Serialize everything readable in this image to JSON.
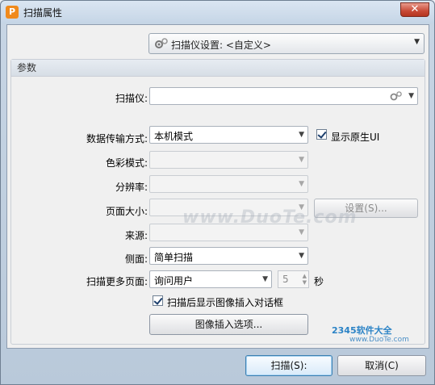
{
  "window": {
    "title": "扫描属性",
    "close": "✕",
    "app_letter": "P"
  },
  "preset": {
    "label": "扫描仪设置: <自定义>"
  },
  "params": {
    "header": "参数",
    "scanner_label": "扫描仪:",
    "scanner_value": "",
    "transfer_label": "数据传输方式:",
    "transfer_value": "本机模式",
    "show_native_label": "显示原生UI",
    "color_label": "色彩模式:",
    "resolution_label": "分辨率:",
    "page_size_label": "页面大小:",
    "page_size_button": "设置(S)...",
    "source_label": "来源:",
    "sides_label": "侧面:",
    "sides_value": "简单扫描",
    "more_pages_label": "扫描更多页面:",
    "more_pages_value": "询问用户",
    "more_pages_count": "5",
    "seconds_label": "秒",
    "show_dialog_label": "扫描后显示图像插入对话框",
    "insert_options_button": "图像插入选项..."
  },
  "footer": {
    "scan_button": "扫描(S):",
    "cancel_button": "取消(C)"
  },
  "watermark": {
    "site": "www.DuoTe.com",
    "logo": "2345软件大全",
    "logo_url": "www.DuoTe.com"
  },
  "icons": {
    "gear": "gear-icon",
    "dropdown": "chevron-down-icon",
    "checkmark": "check-icon"
  }
}
